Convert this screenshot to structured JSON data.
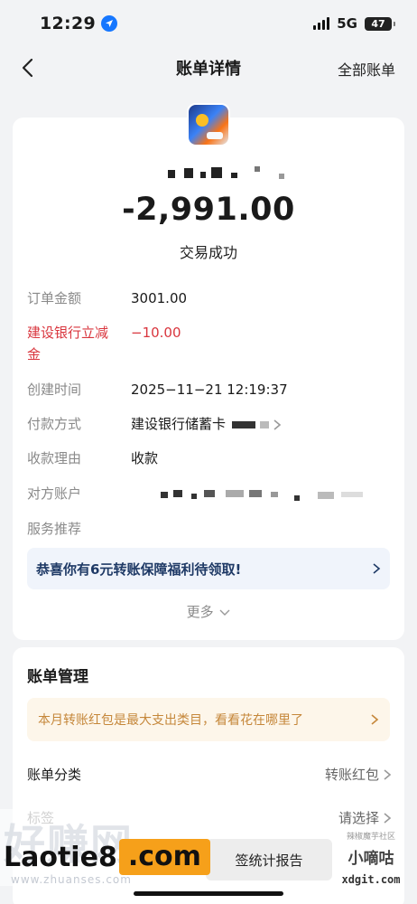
{
  "status_bar": {
    "time": "12:29",
    "network": "5G",
    "battery": "47"
  },
  "nav": {
    "title": "账单详情",
    "right_link": "全部账单"
  },
  "transaction": {
    "amount": "-2,991.00",
    "status": "交易成功"
  },
  "details": {
    "order_amount": {
      "label": "订单金额",
      "value": "3001.00"
    },
    "bank_discount": {
      "label_line1": "建设银行立减",
      "label_line2": "金",
      "value": "−10.00"
    },
    "created_time": {
      "label": "创建时间",
      "value": "2025−11−21 12:19:37"
    },
    "payment_method": {
      "label": "付款方式",
      "value": "建设银行储蓄卡"
    },
    "reason": {
      "label": "收款理由",
      "value": "收款"
    },
    "counterparty": {
      "label": "对方账户"
    },
    "service": {
      "label": "服务推荐"
    }
  },
  "promo": {
    "text": "恭喜你有6元转账保障福利待领取!"
  },
  "more": {
    "label": "更多"
  },
  "management": {
    "title": "账单管理",
    "tip": "本月转账红包是最大支出类目，看看花在哪里了",
    "category": {
      "label": "账单分类",
      "value": "转账红包"
    },
    "tag": {
      "label": "标签",
      "value": "请选择"
    },
    "report_button": "签统计报告"
  },
  "watermark": {
    "left": "Laotie8",
    "right": ".com",
    "ghost": "好赚网",
    "ghost_url": "www.zhuanses.com",
    "xq_small": "辣椒魔芋社区",
    "xq_big": "小嘀咕",
    "xq_url": "xdgit.com"
  },
  "colors": {
    "accent_red": "#d9363e",
    "promo_text": "#1f3a66",
    "tip_text": "#c5873a",
    "watermark_orange": "#f6a01a"
  }
}
